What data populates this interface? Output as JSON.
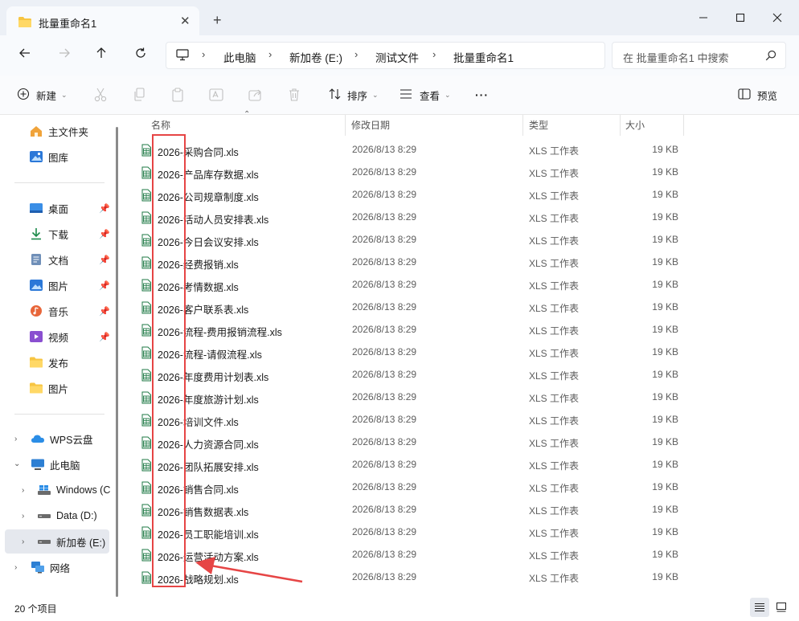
{
  "window": {
    "tab_title": "批量重命名1",
    "new_tab_label": "+",
    "close_tab_label": "✕"
  },
  "address": {
    "crumbs": [
      "此电脑",
      "新加卷 (E:)",
      "测试文件",
      "批量重命名1"
    ],
    "search_placeholder": "在 批量重命名1 中搜索"
  },
  "toolbar": {
    "new_label": "新建",
    "sort_label": "排序",
    "view_label": "查看",
    "more_label": "···",
    "preview_label": "预览"
  },
  "sidebar": {
    "top_items": [
      {
        "label": "主文件夹",
        "icon": "home-icon"
      },
      {
        "label": "图库",
        "icon": "gallery-icon"
      }
    ],
    "quick_items": [
      {
        "label": "桌面",
        "icon": "desktop-icon"
      },
      {
        "label": "下载",
        "icon": "download-icon"
      },
      {
        "label": "文档",
        "icon": "document-icon"
      },
      {
        "label": "图片",
        "icon": "pictures-icon"
      },
      {
        "label": "音乐",
        "icon": "music-icon"
      },
      {
        "label": "视频",
        "icon": "video-icon"
      },
      {
        "label": "发布",
        "icon": "folder-icon"
      },
      {
        "label": "图片",
        "icon": "folder-icon"
      }
    ],
    "tree_items": [
      {
        "label": "WPS云盘",
        "icon": "cloud-icon"
      },
      {
        "label": "此电脑",
        "icon": "pc-icon"
      },
      {
        "label": "Windows (C",
        "icon": "windows-drive-icon"
      },
      {
        "label": "Data (D:)",
        "icon": "drive-icon"
      },
      {
        "label": "新加卷 (E:)",
        "icon": "drive-icon"
      },
      {
        "label": "网络",
        "icon": "network-icon"
      }
    ]
  },
  "columns": {
    "name": "名称",
    "date": "修改日期",
    "type": "类型",
    "size": "大小"
  },
  "files": [
    {
      "name": "2026-采购合同.xls",
      "date": "2026/8/13 8:29",
      "type": "XLS 工作表",
      "size": "19 KB"
    },
    {
      "name": "2026-产品库存数据.xls",
      "date": "2026/8/13 8:29",
      "type": "XLS 工作表",
      "size": "19 KB"
    },
    {
      "name": "2026-公司规章制度.xls",
      "date": "2026/8/13 8:29",
      "type": "XLS 工作表",
      "size": "19 KB"
    },
    {
      "name": "2026-活动人员安排表.xls",
      "date": "2026/8/13 8:29",
      "type": "XLS 工作表",
      "size": "19 KB"
    },
    {
      "name": "2026-今日会议安排.xls",
      "date": "2026/8/13 8:29",
      "type": "XLS 工作表",
      "size": "19 KB"
    },
    {
      "name": "2026-经费报销.xls",
      "date": "2026/8/13 8:29",
      "type": "XLS 工作表",
      "size": "19 KB"
    },
    {
      "name": "2026-考情数据.xls",
      "date": "2026/8/13 8:29",
      "type": "XLS 工作表",
      "size": "19 KB"
    },
    {
      "name": "2026-客户联系表.xls",
      "date": "2026/8/13 8:29",
      "type": "XLS 工作表",
      "size": "19 KB"
    },
    {
      "name": "2026-流程-费用报销流程.xls",
      "date": "2026/8/13 8:29",
      "type": "XLS 工作表",
      "size": "19 KB"
    },
    {
      "name": "2026-流程-请假流程.xls",
      "date": "2026/8/13 8:29",
      "type": "XLS 工作表",
      "size": "19 KB"
    },
    {
      "name": "2026-年度费用计划表.xls",
      "date": "2026/8/13 8:29",
      "type": "XLS 工作表",
      "size": "19 KB"
    },
    {
      "name": "2026-年度旅游计划.xls",
      "date": "2026/8/13 8:29",
      "type": "XLS 工作表",
      "size": "19 KB"
    },
    {
      "name": "2026-培训文件.xls",
      "date": "2026/8/13 8:29",
      "type": "XLS 工作表",
      "size": "19 KB"
    },
    {
      "name": "2026-人力资源合同.xls",
      "date": "2026/8/13 8:29",
      "type": "XLS 工作表",
      "size": "19 KB"
    },
    {
      "name": "2026-团队拓展安排.xls",
      "date": "2026/8/13 8:29",
      "type": "XLS 工作表",
      "size": "19 KB"
    },
    {
      "name": "2026-销售合同.xls",
      "date": "2026/8/13 8:29",
      "type": "XLS 工作表",
      "size": "19 KB"
    },
    {
      "name": "2026-销售数据表.xls",
      "date": "2026/8/13 8:29",
      "type": "XLS 工作表",
      "size": "19 KB"
    },
    {
      "name": "2026-员工职能培训.xls",
      "date": "2026/8/13 8:29",
      "type": "XLS 工作表",
      "size": "19 KB"
    },
    {
      "name": "2026-运营活动方案.xls",
      "date": "2026/8/13 8:29",
      "type": "XLS 工作表",
      "size": "19 KB"
    },
    {
      "name": "2026-战略规划.xls",
      "date": "2026/8/13 8:29",
      "type": "XLS 工作表",
      "size": "19 KB"
    }
  ],
  "status": {
    "count_text": "20 个项目"
  },
  "colors": {
    "folder": "#f7c542",
    "xls_green": "#1f7a46",
    "annotation_red": "#e64545",
    "accent": "#0067c0"
  }
}
